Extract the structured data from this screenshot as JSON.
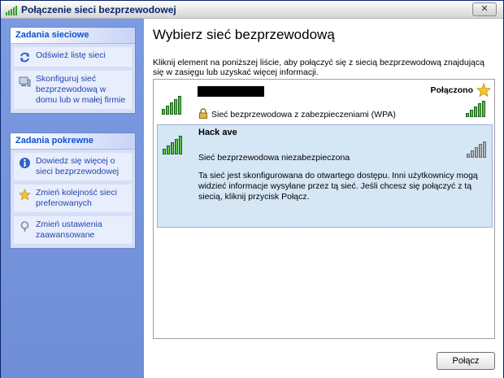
{
  "window": {
    "title": "Połączenie sieci bezprzewodowej",
    "close_label": "✕"
  },
  "sidebar": {
    "network_tasks": {
      "header": "Zadania sieciowe",
      "items": [
        {
          "label": "Odśwież listę sieci",
          "icon": "refresh-icon"
        },
        {
          "label": "Skonfiguruj sieć bezprzewodową w domu lub w małej firmie",
          "icon": "setup-network-icon"
        }
      ]
    },
    "related_tasks": {
      "header": "Zadania pokrewne",
      "items": [
        {
          "label": "Dowiedz się więcej o sieci bezprzewodowej",
          "icon": "info-icon"
        },
        {
          "label": "Zmień kolejność sieci preferowanych",
          "icon": "star-icon"
        },
        {
          "label": "Zmień ustawienia zaawansowane",
          "icon": "settings-icon"
        }
      ]
    }
  },
  "main": {
    "heading": "Wybierz sieć bezprzewodową",
    "instruction": "Kliknij element na poniższej liście, aby połączyć się z siecią bezprzewodową znajdującą się w zasięgu lub uzyskać więcej informacji.",
    "networks": [
      {
        "ssid": "",
        "status": "Połączono",
        "security": "Sieć bezprzewodowa z zabezpieczeniami (WPA)",
        "signal_bars": 5
      },
      {
        "ssid": "Hack ave",
        "security": "Sieć bezprzewodowa niezabezpieczona",
        "description": "Ta sieć jest skonfigurowana do otwartego dostępu. Inni użytkownicy mogą widzieć informacje wysyłane przez tą sieć. Jeśli chcesz się połączyć z tą siecią, kliknij przycisk Połącz.",
        "signal_bars": 3
      }
    ],
    "connect_button": "Połącz"
  },
  "colors": {
    "accent": "#0d52d0",
    "sidebar_bg": "#7b9ae0",
    "selected_row": "#d5e6f5"
  }
}
